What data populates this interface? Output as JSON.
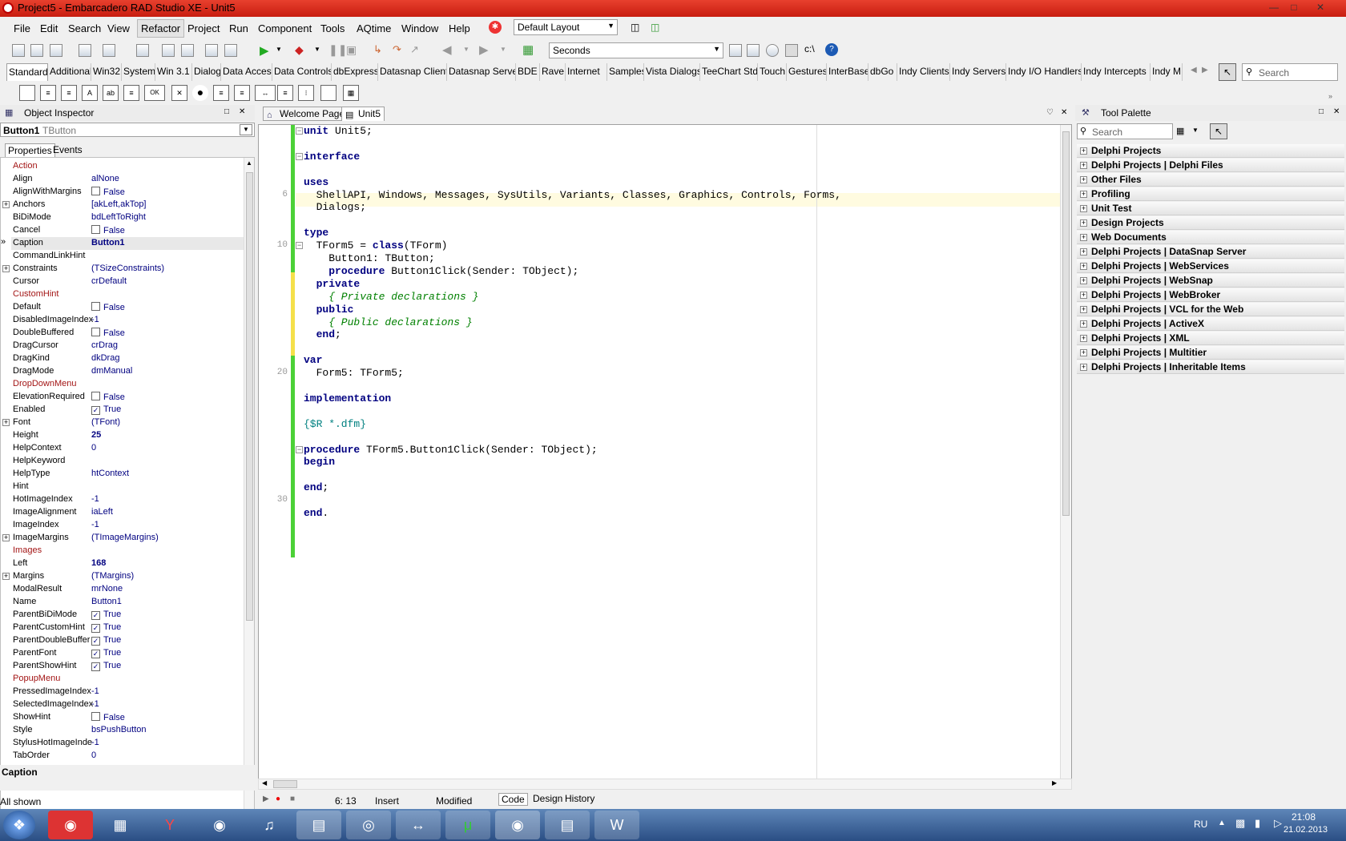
{
  "window": {
    "title": "Project5 - Embarcadero RAD Studio XE - Unit5"
  },
  "menu": [
    "File",
    "Edit",
    "Search",
    "View",
    "Refactor",
    "Project",
    "Run",
    "Component",
    "Tools",
    "AQtime",
    "Window",
    "Help"
  ],
  "layout_combo": "Default Layout",
  "seconds_combo": "Seconds",
  "search_placeholder": "Search",
  "component_tabs": [
    "Standard",
    "Additional",
    "Win32",
    "System",
    "Win 3.1",
    "Dialogs",
    "Data Access",
    "Data Controls",
    "dbExpress",
    "Datasnap Client",
    "Datasnap Server",
    "BDE",
    "Rave",
    "Internet",
    "Samples",
    "Vista Dialogs",
    "TeeChart Std",
    "Touch",
    "Gestures",
    "InterBase",
    "dbGo",
    "Indy Clients",
    "Indy Servers",
    "Indy I/O Handlers",
    "Indy Intercepts",
    "Indy M"
  ],
  "object_inspector": {
    "title": "Object Inspector",
    "selected_name": "Button1",
    "selected_type": "TButton",
    "tab_properties": "Properties",
    "tab_events": "Events",
    "properties": [
      {
        "n": "Action",
        "v": "",
        "red": true
      },
      {
        "n": "Align",
        "v": "alNone"
      },
      {
        "n": "AlignWithMargins",
        "v": "False",
        "chk": ""
      },
      {
        "n": "Anchors",
        "v": "[akLeft,akTop]",
        "exp": true
      },
      {
        "n": "BiDiMode",
        "v": "bdLeftToRight"
      },
      {
        "n": "Cancel",
        "v": "False",
        "chk": ""
      },
      {
        "n": "Caption",
        "v": "Button1",
        "bold": true,
        "sel": true
      },
      {
        "n": "CommandLinkHint",
        "v": ""
      },
      {
        "n": "Constraints",
        "v": "(TSizeConstraints)",
        "exp": true
      },
      {
        "n": "Cursor",
        "v": "crDefault"
      },
      {
        "n": "CustomHint",
        "v": "",
        "red": true
      },
      {
        "n": "Default",
        "v": "False",
        "chk": ""
      },
      {
        "n": "DisabledImageIndex",
        "v": "-1"
      },
      {
        "n": "DoubleBuffered",
        "v": "False",
        "chk": ""
      },
      {
        "n": "DragCursor",
        "v": "crDrag"
      },
      {
        "n": "DragKind",
        "v": "dkDrag"
      },
      {
        "n": "DragMode",
        "v": "dmManual"
      },
      {
        "n": "DropDownMenu",
        "v": "",
        "red": true
      },
      {
        "n": "ElevationRequired",
        "v": "False",
        "chk": ""
      },
      {
        "n": "Enabled",
        "v": "True",
        "chk": "✓"
      },
      {
        "n": "Font",
        "v": "(TFont)",
        "exp": true
      },
      {
        "n": "Height",
        "v": "25",
        "bold": true
      },
      {
        "n": "HelpContext",
        "v": "0"
      },
      {
        "n": "HelpKeyword",
        "v": ""
      },
      {
        "n": "HelpType",
        "v": "htContext"
      },
      {
        "n": "Hint",
        "v": ""
      },
      {
        "n": "HotImageIndex",
        "v": "-1"
      },
      {
        "n": "ImageAlignment",
        "v": "iaLeft"
      },
      {
        "n": "ImageIndex",
        "v": "-1"
      },
      {
        "n": "ImageMargins",
        "v": "(TImageMargins)",
        "exp": true
      },
      {
        "n": "Images",
        "v": "",
        "red": true
      },
      {
        "n": "Left",
        "v": "168",
        "bold": true
      },
      {
        "n": "Margins",
        "v": "(TMargins)",
        "exp": true
      },
      {
        "n": "ModalResult",
        "v": "mrNone"
      },
      {
        "n": "Name",
        "v": "Button1"
      },
      {
        "n": "ParentBiDiMode",
        "v": "True",
        "chk": "✓"
      },
      {
        "n": "ParentCustomHint",
        "v": "True",
        "chk": "✓"
      },
      {
        "n": "ParentDoubleBuffer",
        "v": "True",
        "chk": "✓"
      },
      {
        "n": "ParentFont",
        "v": "True",
        "chk": "✓"
      },
      {
        "n": "ParentShowHint",
        "v": "True",
        "chk": "✓"
      },
      {
        "n": "PopupMenu",
        "v": "",
        "red": true
      },
      {
        "n": "PressedImageIndex",
        "v": "-1"
      },
      {
        "n": "SelectedImageIndex",
        "v": "-1"
      },
      {
        "n": "ShowHint",
        "v": "False",
        "chk": ""
      },
      {
        "n": "Style",
        "v": "bsPushButton"
      },
      {
        "n": "StylusHotImageInde",
        "v": "-1"
      },
      {
        "n": "TabOrder",
        "v": "0"
      }
    ],
    "description": "Caption",
    "footer": "All shown"
  },
  "editor": {
    "tabs": [
      "Welcome Page",
      "Unit5"
    ],
    "line_numbers": [
      {
        "n": "6",
        "row": 5
      },
      {
        "n": "10",
        "row": 9
      },
      {
        "n": "20",
        "row": 19
      },
      {
        "n": "30",
        "row": 29
      }
    ],
    "status_pos": "6: 13",
    "status_mode": "Insert",
    "status_modified": "Modified",
    "bottom_tabs": [
      "Code",
      "Design",
      "History"
    ]
  },
  "tool_palette": {
    "title": "Tool Palette",
    "search_placeholder": "Search",
    "categories": [
      "Delphi Projects",
      "Delphi Projects | Delphi Files",
      "Other Files",
      "Profiling",
      "Unit Test",
      "Design Projects",
      "Web Documents",
      "Delphi Projects | DataSnap Server",
      "Delphi Projects | WebServices",
      "Delphi Projects | WebSnap",
      "Delphi Projects | WebBroker",
      "Delphi Projects | VCL for the Web",
      "Delphi Projects | ActiveX",
      "Delphi Projects | XML",
      "Delphi Projects | Multitier",
      "Delphi Projects | Inheritable Items"
    ]
  },
  "taskbar": {
    "lang": "RU",
    "time": "21:08",
    "date": "21.02.2013"
  }
}
